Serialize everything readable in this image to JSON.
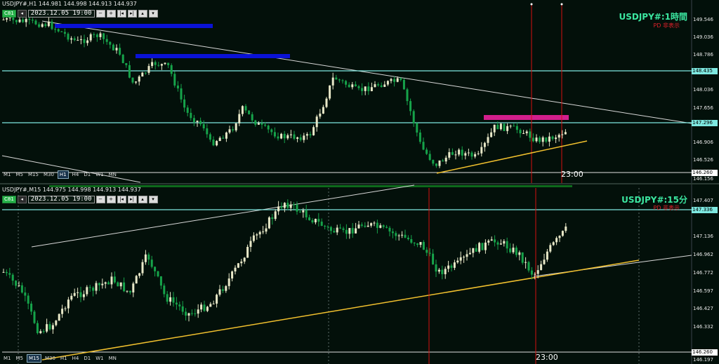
{
  "upper": {
    "symbol_line": "USDJPY#,H1  144.981 144.998 144.913 144.937",
    "period_badge": "C81",
    "datetime": "2023.12.05 19:00",
    "title": "USDJPY#:1時間",
    "subtitle": "PD 非表示",
    "timeframes": [
      "M1",
      "M5",
      "M15",
      "M30",
      "H1",
      "H4",
      "D1",
      "W1",
      "MN"
    ],
    "active_timeframe": "H1",
    "price_ticks": [
      "149.546",
      "149.036",
      "148.786",
      "148.435",
      "148.036",
      "147.656",
      "147.296",
      "146.906",
      "146.526",
      "146.260",
      "146.156"
    ],
    "highlight_prices": {
      "cyan_upper": "148.435",
      "cyan_lower": "147.296",
      "white_bottom": "146.260"
    },
    "time_label": "23:00"
  },
  "lower": {
    "symbol_line": "USDJPY#,M15  144.975 144.998 144.913 144.937",
    "period_badge": "C81",
    "datetime": "2023.12.05 19:00",
    "title": "USDJPY#:15分",
    "subtitle": "PD 非表示",
    "timeframes": [
      "M1",
      "M5",
      "M15",
      "M30",
      "H1",
      "H4",
      "D1",
      "W1",
      "MN"
    ],
    "active_timeframe": "M15",
    "price_ticks": [
      "147.407",
      "147.336",
      "147.136",
      "146.962",
      "146.772",
      "146.597",
      "146.427",
      "146.332",
      "146.260",
      "146.197"
    ],
    "highlight_prices": {
      "cyan_upper": "147.336",
      "white_bottom": "146.260"
    },
    "time_label": "23:00"
  },
  "colors": {
    "bull": "#e8e8c8",
    "bear": "#16a34a",
    "cyan": "#7ee8e0",
    "blue": "#0a12d6",
    "magenta": "#d21f8c",
    "yellow": "#f2c12e",
    "red": "#d61010"
  }
}
